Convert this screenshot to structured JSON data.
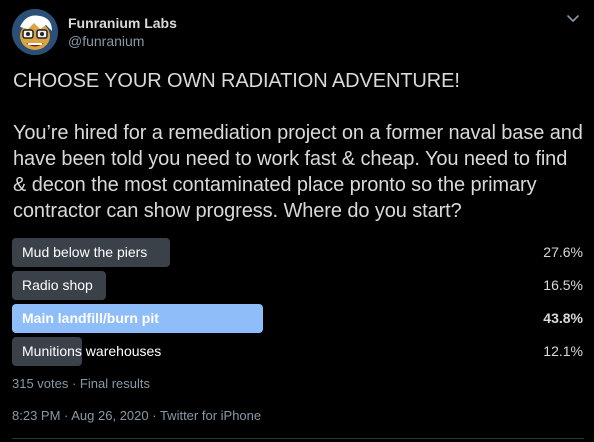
{
  "author": {
    "display_name": "Funranium Labs",
    "handle": "@funranium"
  },
  "tweet": {
    "text": "CHOOSE YOUR OWN RADIATION ADVENTURE!\n\nYou’re hired for a remediation project on a former naval base and have been told you need to work fast & cheap. You need to find & decon the most contaminated place pronto so the primary contractor can show progress. Where do you start?"
  },
  "poll": {
    "options": [
      {
        "label": "Mud below the piers",
        "percent_text": "27.6%",
        "percent": 27.6,
        "winner": false
      },
      {
        "label": "Radio shop",
        "percent_text": "16.5%",
        "percent": 16.5,
        "winner": false
      },
      {
        "label": "Main landfill/burn pit",
        "percent_text": "43.8%",
        "percent": 43.8,
        "winner": true
      },
      {
        "label": "Munitions warehouses",
        "percent_text": "12.1%",
        "percent": 12.1,
        "winner": false
      }
    ],
    "summary": "315 votes · Final results"
  },
  "meta": {
    "time": "8:23 PM",
    "sep1": " · ",
    "date": "Aug 26, 2020",
    "sep2": " · ",
    "source": "Twitter for iPhone"
  },
  "colors": {
    "background": "#000000",
    "bar": "#3a4149",
    "bar_winner": "#8ebdfa",
    "secondary_text": "#8899a6"
  },
  "icons": {
    "more": "chevron-down-icon",
    "avatar": "avatar-illustration"
  }
}
